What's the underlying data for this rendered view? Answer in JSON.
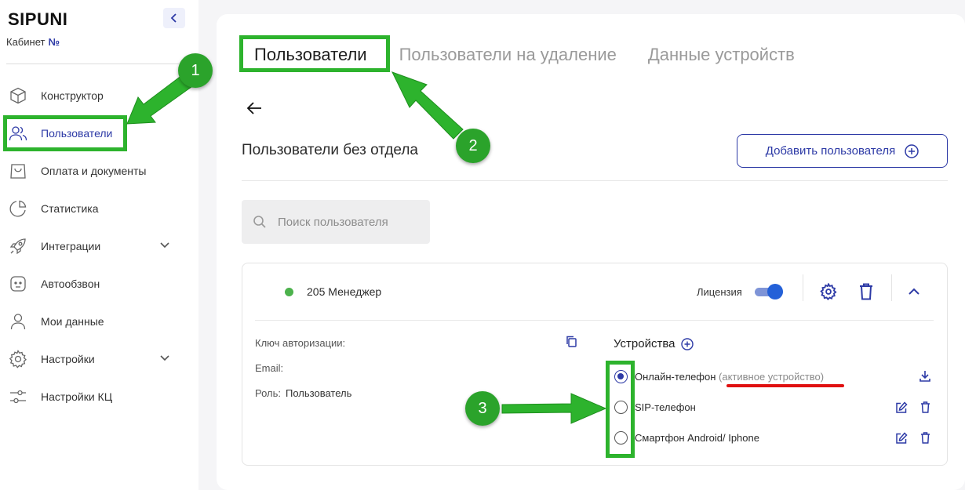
{
  "sidebar": {
    "logo": "SIPUNI",
    "cabinet_label": "Кабинет",
    "cabinet_number": "№",
    "items": [
      {
        "label": "Конструктор",
        "icon": "cube-icon"
      },
      {
        "label": "Пользователи",
        "icon": "users-icon",
        "active": true
      },
      {
        "label": "Оплата и документы",
        "icon": "shopping-bag-icon"
      },
      {
        "label": "Статистика",
        "icon": "pie-chart-icon"
      },
      {
        "label": "Интеграции",
        "icon": "rocket-icon",
        "expandable": true
      },
      {
        "label": "Автообзвон",
        "icon": "robot-face-icon"
      },
      {
        "label": "Мои данные",
        "icon": "person-icon"
      },
      {
        "label": "Настройки",
        "icon": "gear-icon",
        "expandable": true
      },
      {
        "label": "Настройки КЦ",
        "icon": "sliders-icon"
      }
    ]
  },
  "tabs": [
    {
      "label": "Пользователи",
      "active": true
    },
    {
      "label": "Пользователи на удаление"
    },
    {
      "label": "Данные устройств"
    }
  ],
  "section": {
    "title": "Пользователи без отдела",
    "add_button": "Добавить пользователя"
  },
  "search": {
    "placeholder": "Поиск пользователя"
  },
  "user_card": {
    "name": "205 Менеджер",
    "status": "online",
    "license_label": "Лицензия",
    "license_enabled": true,
    "auth_key_label": "Ключ авторизации:",
    "email_label": "Email:",
    "role_label": "Роль:",
    "role_value": "Пользователь",
    "devices_title": "Устройства",
    "devices": [
      {
        "label": "Онлайн-телефон",
        "note": "(активное устройство)",
        "selected": true
      },
      {
        "label": "SIP-телефон",
        "selected": false
      },
      {
        "label": "Смартфон Android/ Iphone",
        "selected": false
      }
    ]
  },
  "annotations": {
    "badges": [
      "1",
      "2",
      "3"
    ],
    "highlight_color": "#2db32d",
    "underline_color": "#e01010"
  },
  "colors": {
    "accent": "#2d3aa6",
    "status_online": "#4cb24c"
  }
}
